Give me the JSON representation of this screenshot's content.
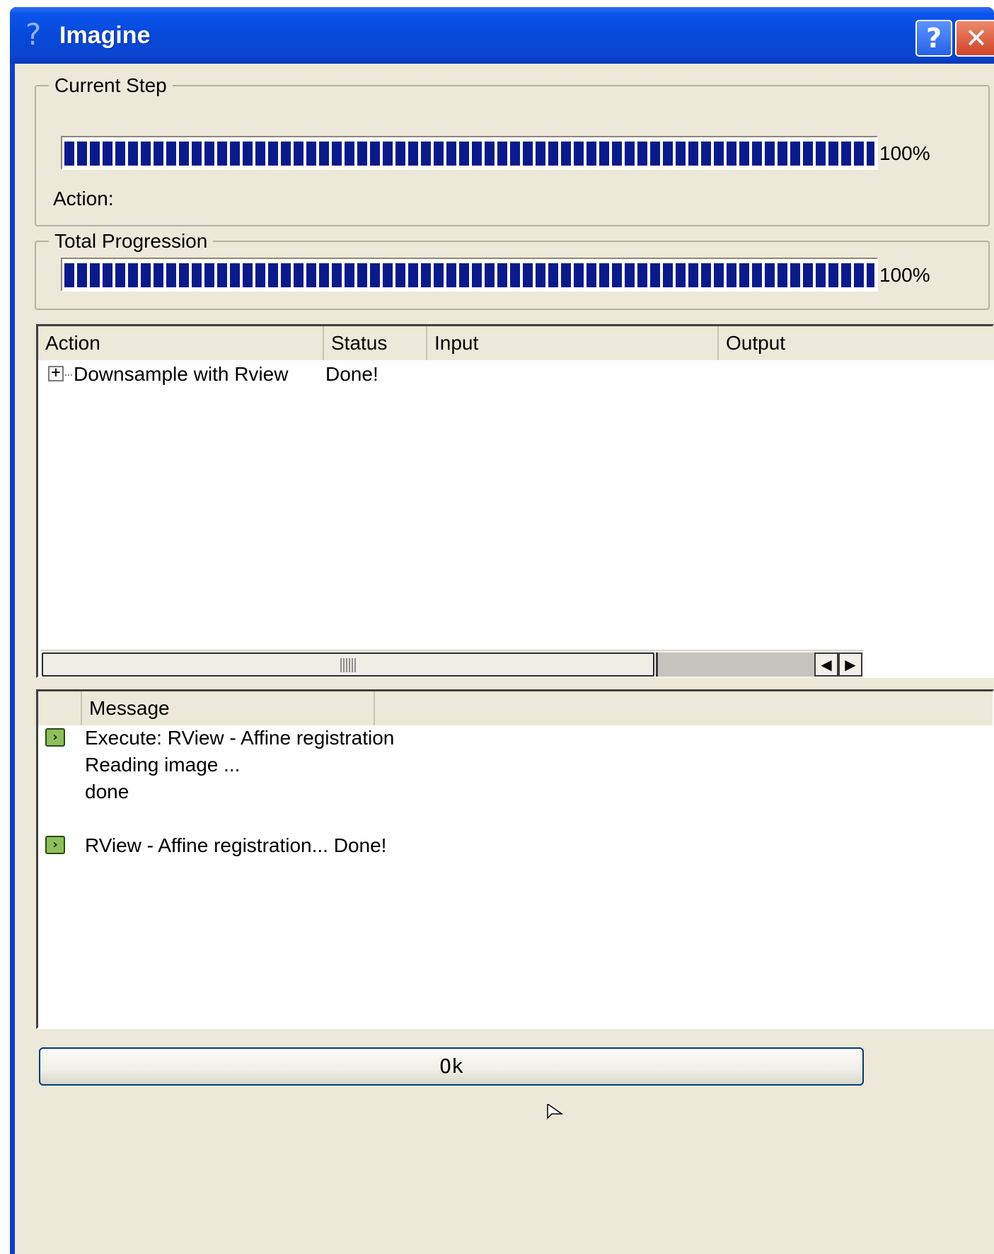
{
  "window": {
    "title": "Imagine",
    "title_icon": "?",
    "help_button": "?",
    "close_button": "✕"
  },
  "current_step": {
    "label": "Current Step",
    "progress_percent": 100,
    "progress_text": "100%",
    "action_label": "Action:"
  },
  "total_progression": {
    "label": "Total Progression",
    "progress_percent": 100,
    "progress_text": "100%"
  },
  "actions_table": {
    "columns": [
      "Action",
      "Status",
      "Input",
      "Output"
    ],
    "rows": [
      {
        "action": "Downsample with Rview",
        "status": "Done!",
        "input": "",
        "output": "",
        "expander": "+"
      }
    ]
  },
  "messages_table": {
    "columns": [
      "",
      "Message"
    ],
    "lines": [
      {
        "icon": "play-icon",
        "text": "Execute: RView - Affine registration"
      },
      {
        "icon": "",
        "text": "Reading image ..."
      },
      {
        "icon": "",
        "text": "done"
      },
      {
        "icon": "play-icon",
        "text": "RView - Affine registration... Done!"
      }
    ]
  },
  "scrollbar": {
    "left_arrow": "◀",
    "right_arrow": "▶"
  },
  "buttons": {
    "ok": "Ok"
  },
  "colors": {
    "progress": "#0a1a8c",
    "titlebar": "#0648d8",
    "dialog_bg": "#ece9d8"
  }
}
